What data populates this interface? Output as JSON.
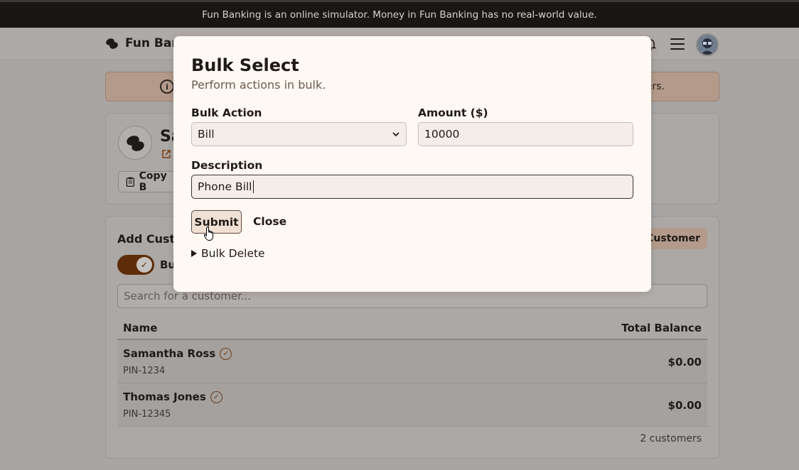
{
  "banner": {
    "text": "Fun Banking is an online simulator. Money in Fun Banking has no real-world value."
  },
  "navbar": {
    "brand": "Fun Ban"
  },
  "notice": {
    "icon": "i",
    "tail": "ers."
  },
  "bank_card": {
    "title": "Sa",
    "copy_label": "Copy B"
  },
  "customers": {
    "title": "Add Custo",
    "add_button": "l Customer",
    "toggle_label": "Bu",
    "search_placeholder": "Search for a customer...",
    "columns": {
      "name": "Name",
      "balance": "Total Balance"
    },
    "rows": [
      {
        "name": "Samantha Ross",
        "pin": "PIN-1234",
        "balance": "$0.00"
      },
      {
        "name": "Thomas Jones",
        "pin": "PIN-12345",
        "balance": "$0.00"
      }
    ],
    "count": "2 customers"
  },
  "modal": {
    "title": "Bulk Select",
    "subtitle": "Perform actions in bulk.",
    "action_label": "Bulk Action",
    "action_value": "Bill",
    "amount_label": "Amount ($)",
    "amount_value": "10000",
    "description_label": "Description",
    "description_value": "Phone Bill",
    "submit_label": "Submit",
    "close_label": "Close",
    "bulk_delete_label": "Bulk Delete"
  }
}
